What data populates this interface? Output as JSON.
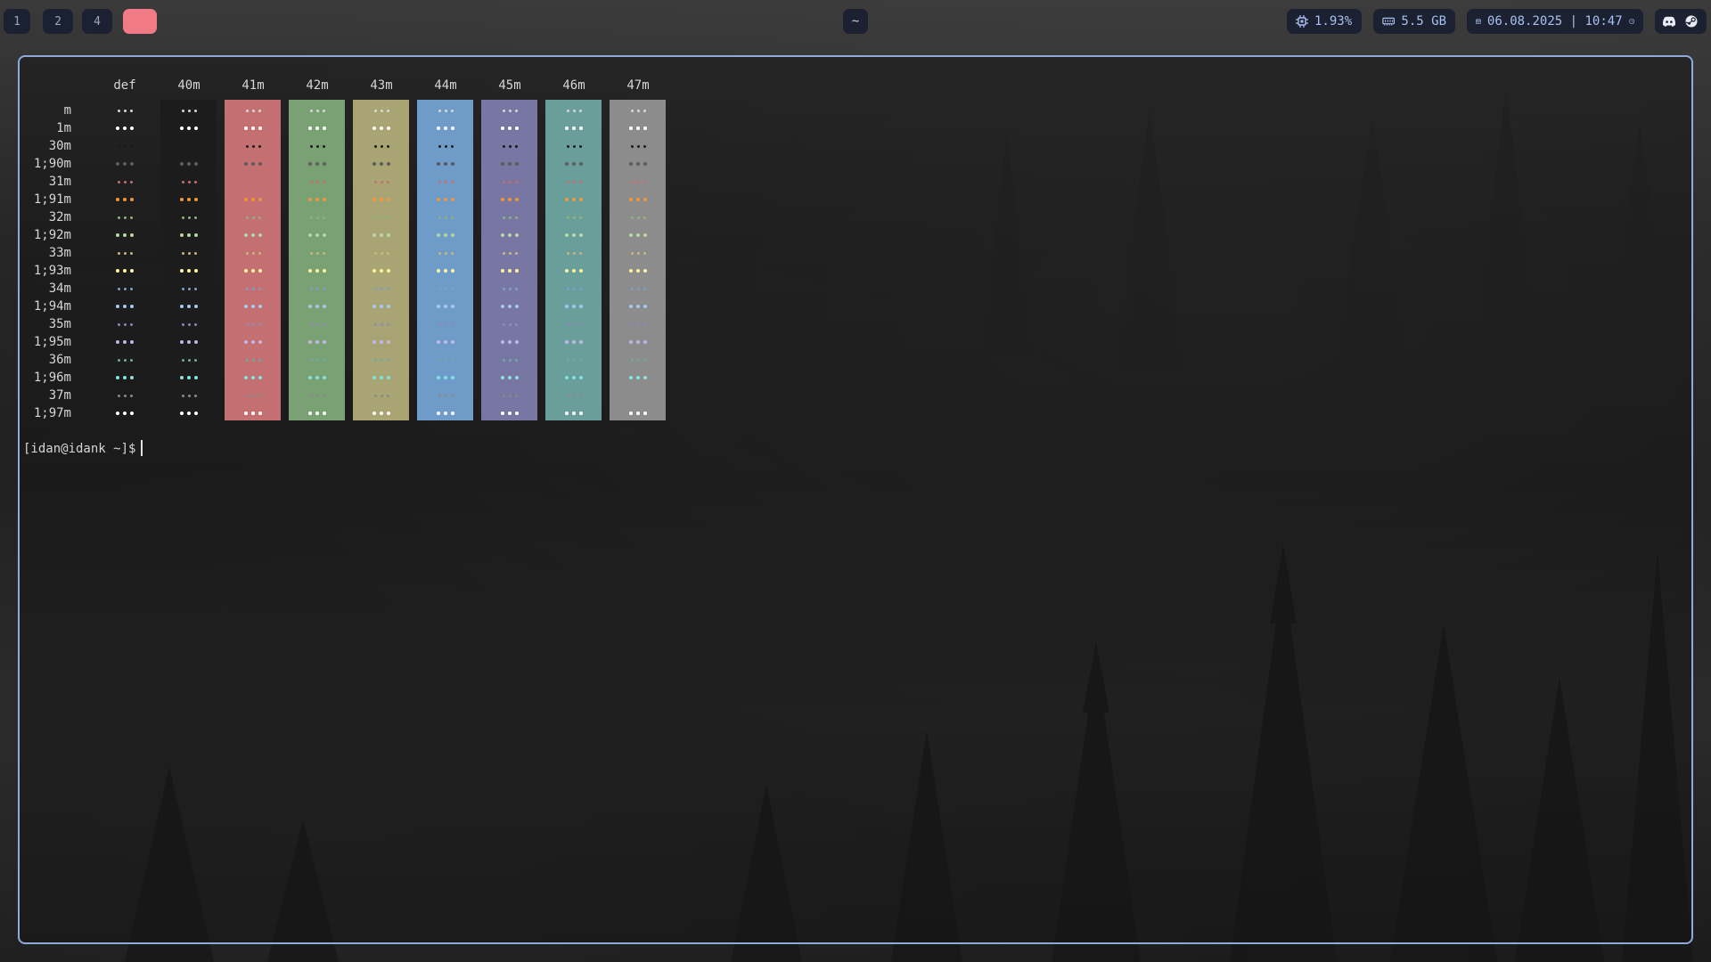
{
  "workspaces": [
    {
      "label": "1",
      "active": false
    },
    {
      "label": "2",
      "active": false
    },
    {
      "label": "4",
      "active": false
    },
    {
      "label": "",
      "active": true
    }
  ],
  "center_label": "~",
  "status": {
    "cpu": "1.93%",
    "memory": "5.5 GB",
    "datetime": "06.08.2025 | 10:47",
    "icons": [
      "cpu-icon",
      "memory-icon",
      "calendar-icon",
      "clock-icon",
      "discord-icon",
      "steam-icon"
    ]
  },
  "terminal": {
    "columns": [
      "def",
      "40m",
      "41m",
      "42m",
      "43m",
      "44m",
      "45m",
      "46m",
      "47m"
    ],
    "column_bg": [
      "",
      "#1c1c1c",
      "#c46f71",
      "#7aa173",
      "#a8a474",
      "#6f9bc8",
      "#7876a3",
      "#6a9e9a",
      "#8c8c8c"
    ],
    "rows": [
      "m",
      "1m",
      "30m",
      "1;90m",
      "31m",
      "1;91m",
      "32m",
      "1;92m",
      "33m",
      "1;93m",
      "34m",
      "1;94m",
      "35m",
      "1;95m",
      "36m",
      "1;96m",
      "37m",
      "1;97m"
    ],
    "row_fg": [
      "#d8d8d8",
      "#ffffff",
      "#1a1a1a",
      "#5c5c5c",
      "#c46f71",
      "#f0963c",
      "#8fb07f",
      "#b6d6a6",
      "#c7b77e",
      "#fff4a0",
      "#7f9fc8",
      "#a6c8f0",
      "#9088b8",
      "#c2b6e8",
      "#72a8a4",
      "#86e0e0",
      "#8a8a8a",
      "#ffffff"
    ],
    "prompt": "[idan@idank ~]$"
  }
}
